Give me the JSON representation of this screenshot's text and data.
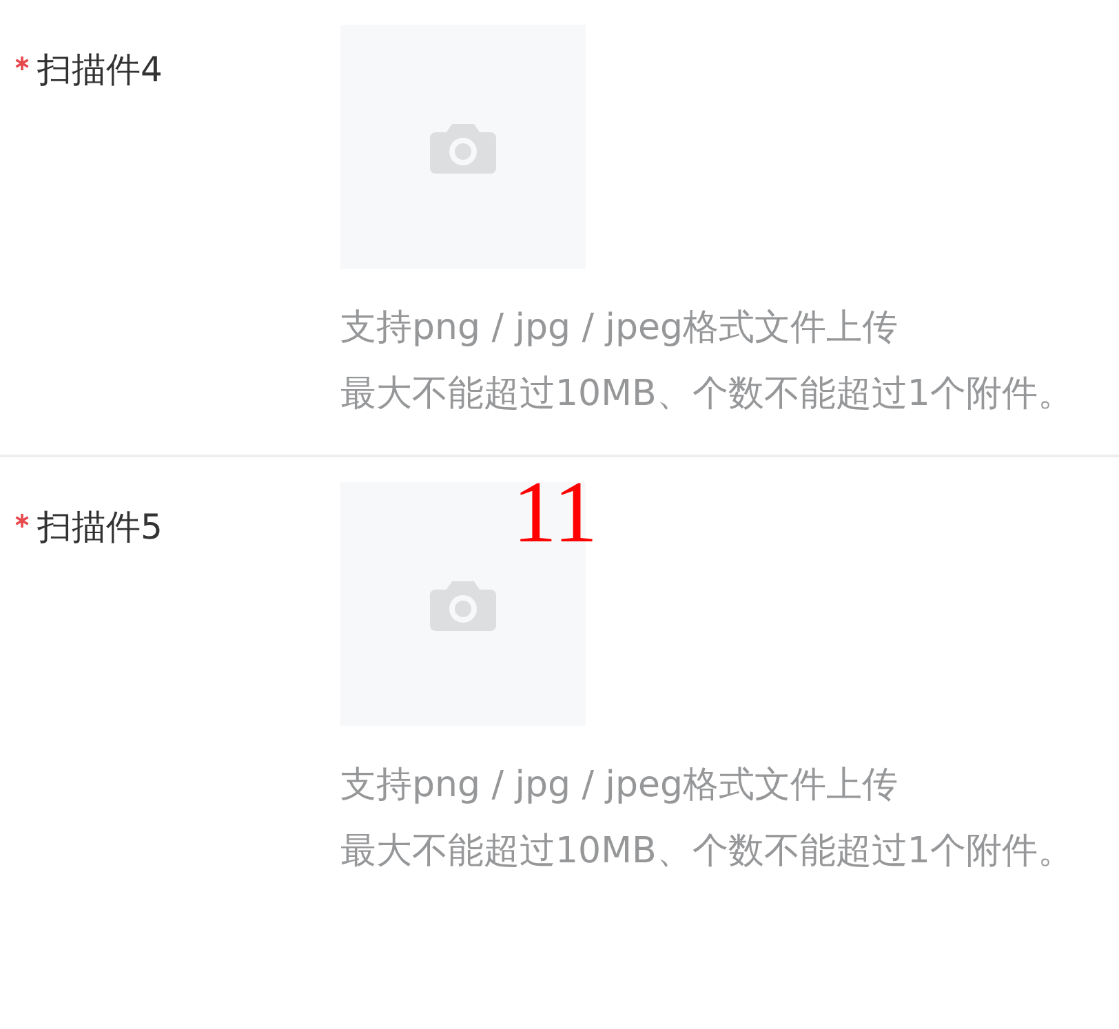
{
  "fields": [
    {
      "label": "扫描件4",
      "required": true,
      "hint_lines": [
        "支持png / jpg / jpeg格式文件上传",
        "最大不能超过10MB、个数不能超过1个附件。"
      ]
    },
    {
      "label": "扫描件5",
      "required": true,
      "hint_lines": [
        "支持png / jpg / jpeg格式文件上传",
        "最大不能超过10MB、个数不能超过1个附件。"
      ]
    }
  ],
  "page_marker": "11"
}
